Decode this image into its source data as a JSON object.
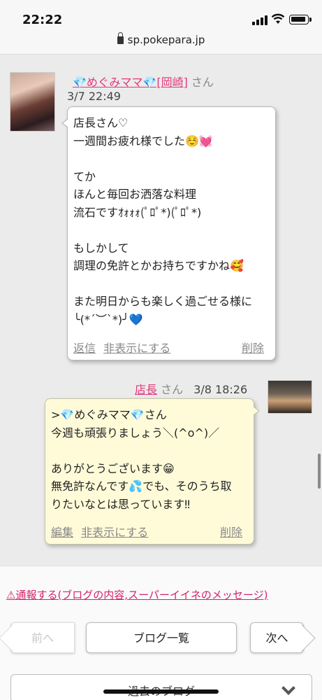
{
  "status_bar": {
    "time": "22:22",
    "url": "sp.pokepara.jp"
  },
  "messages": [
    {
      "author": "💎めぐみママ💎[岡崎]",
      "suffix": "さん",
      "timestamp": "3/7 22:49",
      "text": "店長さん♡\n一週間お疲れ様でした☺️💓\n\nてか\nほんと毎回お洒落な料理\n流石ですｵｫｫｫ(ﾟﾛﾟ*)(ﾟﾛﾟ*)\n\nもしかして\n調理の免許とかお持ちですかね🥰\n\nまた明日からも楽しく過ごせる様に\n╰(*´︶`*)╯💙",
      "actions": [
        "返信",
        "非表示にする"
      ],
      "delete_label": "削除"
    },
    {
      "author": "店長",
      "suffix": "さん",
      "timestamp": "3/8 18:26",
      "text": ">💎めぐみママ💎さん\n今週も頑張りましょう＼(^o^)／\n\nありがとうございます😁\n無免許なんです💦でも、そのうち取\nりたいなとは思っています‼︎",
      "actions": [
        "編集",
        "非表示にする"
      ],
      "delete_label": "削除"
    }
  ],
  "footer": {
    "report_link": "⚠通報する(ブログの内容,スーパーイイネのメッセージ)",
    "prev_label": "前へ",
    "list_label": "ブログ一覧",
    "next_label": "次へ",
    "archive_label": "過去のブログ"
  }
}
